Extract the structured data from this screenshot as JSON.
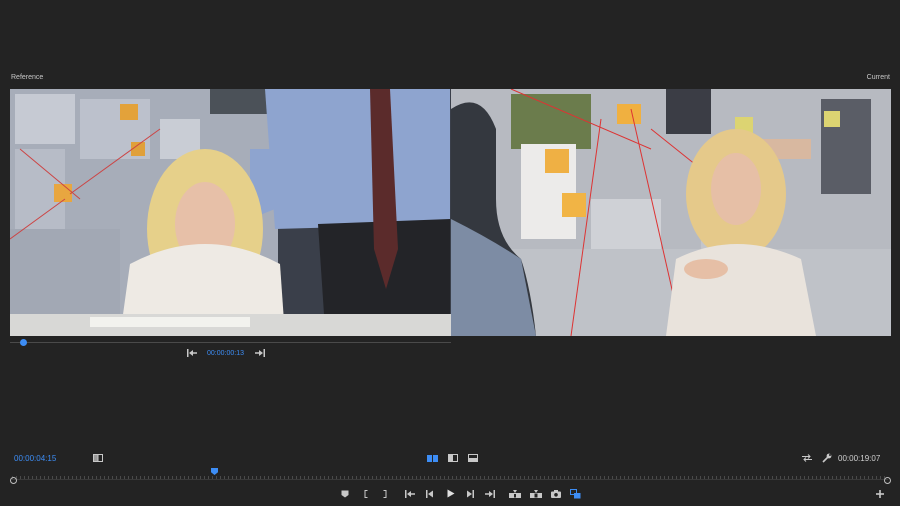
{
  "monitors": {
    "reference_label": "Reference",
    "current_label": "Current"
  },
  "reference": {
    "timecode": "00:00:00:13",
    "progress": 0.03
  },
  "toolbar": {
    "left_timecode": "00:00:04:15",
    "right_timecode": "00:00:19:07",
    "playhead_position": 0.23
  },
  "icons": {
    "ref_step_back": "step-back-to-in-icon",
    "ref_step_forward": "step-forward-to-out-icon",
    "side_by_side": "side-by-side-view-icon",
    "vertical_split": "vertical-split-view-icon",
    "horizontal_split": "horizontal-split-view-icon",
    "swap": "swap-icon",
    "settings": "wrench-icon"
  },
  "colors": {
    "accent": "#3d8df5",
    "background": "#232323"
  }
}
